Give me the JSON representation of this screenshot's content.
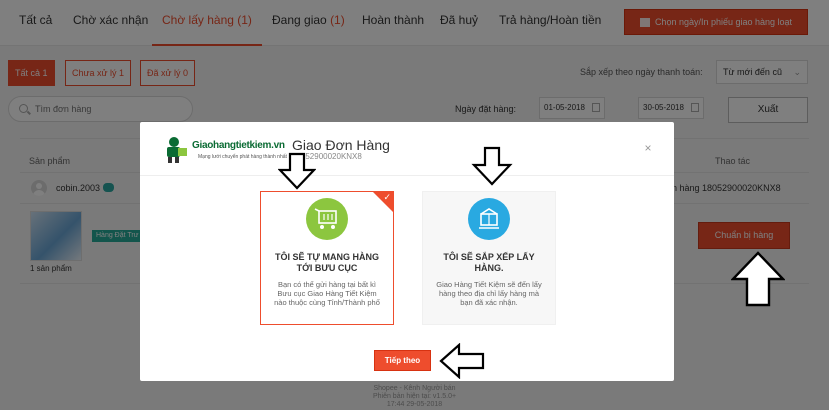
{
  "tabs": [
    {
      "label": "Tất cả",
      "count": ""
    },
    {
      "label": "Chờ xác nhận",
      "count": ""
    },
    {
      "label": "Chờ lấy hàng",
      "count": "(1)"
    },
    {
      "label": "Đang giao",
      "count": "(1)"
    },
    {
      "label": "Hoàn thành",
      "count": ""
    },
    {
      "label": "Đã huỷ",
      "count": ""
    },
    {
      "label": "Trả hàng/Hoàn tiền",
      "count": ""
    }
  ],
  "bulk_button": "Chọn ngày/In phiếu giao hàng loạt",
  "subfilters": [
    "Tất cả 1",
    "Chưa xử lý 1",
    "Đã xử lý 0"
  ],
  "sort": {
    "label": "Sắp xếp theo ngày thanh toán:",
    "value": "Từ mới đến cũ"
  },
  "search": {
    "placeholder": "Tìm đơn hàng"
  },
  "date_filter": {
    "label": "Ngày đặt hàng:",
    "from": "01-05-2018",
    "to": "30-05-2018"
  },
  "export_label": "Xuất",
  "columns": {
    "product": "Sản phẩm",
    "action": "Thao tác"
  },
  "order": {
    "buyer": "cobin.2003",
    "tracking": "n hàng 18052900020KNX8",
    "badge": "Hàng Đặt Trư",
    "qty": "1 sản phẩm",
    "prepare_label": "Chuẩn bị hàng"
  },
  "footer": [
    "Shopee - Kênh Người bán",
    "Phiên bản hiện tại: v1.5.0+",
    "17:44 29-05-2018"
  ],
  "modal": {
    "logo_title": "Giaohangtietkiem.vn",
    "logo_sub": "Mạng lưới chuyển phát hàng thành nhất",
    "title": "Giao Đơn Hàng",
    "code": "18052900020KNX8",
    "close": "×",
    "options": [
      {
        "title": "TÔI SẼ TỰ MANG HÀNG TỚI BƯU CỤC",
        "desc": "Bạn có thể gửi hàng tại bất kì Bưu cục Giao Hàng Tiết Kiệm nào thuộc cùng Tỉnh/Thành phố",
        "selected": true
      },
      {
        "title": "TÔI SẼ SẮP XẾP LẤY HÀNG.",
        "desc": "Giao Hàng Tiết Kiệm sẽ đến lấy hàng theo địa chỉ lấy hàng mà bạn đã xác nhận.",
        "selected": false
      }
    ],
    "next_label": "Tiếp theo"
  },
  "colors": {
    "brand": "#ee4d2d",
    "dropoff_icon": "#8cc63f",
    "pickup_icon": "#29a9e1",
    "badge": "#26aa99"
  }
}
